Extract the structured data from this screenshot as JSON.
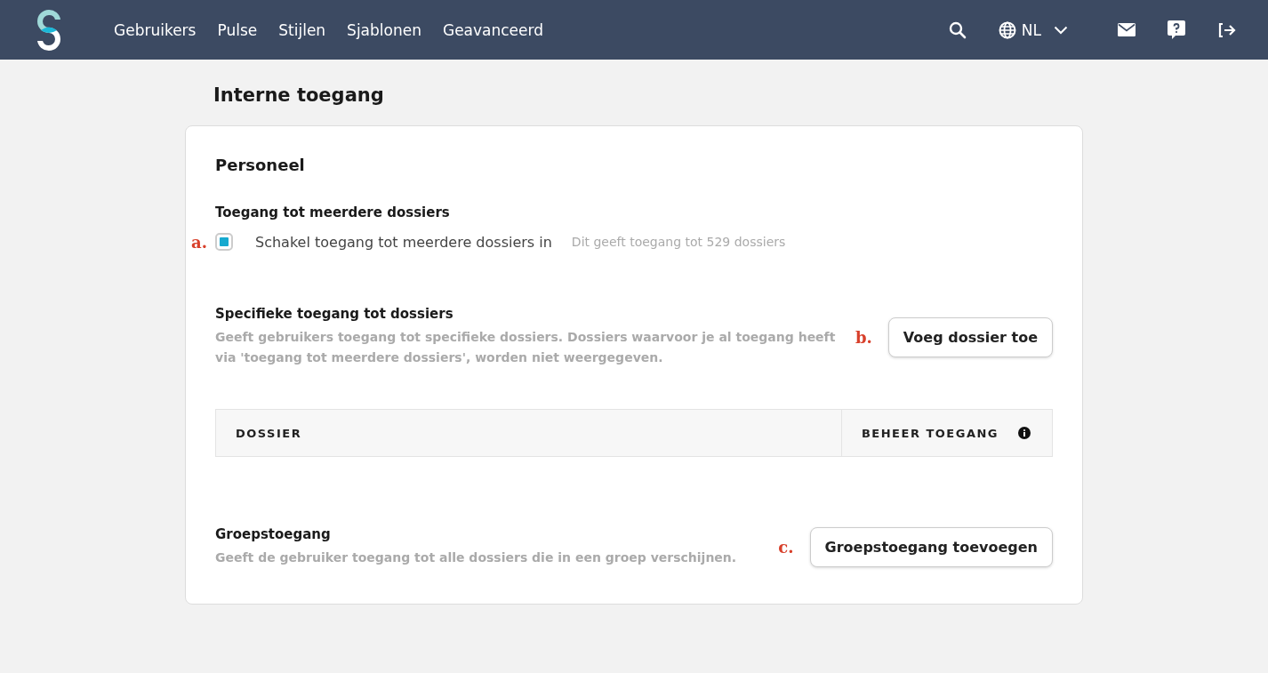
{
  "nav": {
    "items": [
      {
        "label": "Gebruikers"
      },
      {
        "label": "Pulse"
      },
      {
        "label": "Stijlen"
      },
      {
        "label": "Sjablonen"
      },
      {
        "label": "Geavanceerd"
      }
    ],
    "language": "NL"
  },
  "page_title": "Interne toegang",
  "card": {
    "title": "Personeel",
    "multi_access": {
      "heading": "Toegang tot meerdere dossiers",
      "marker": "a.",
      "checkbox": {
        "label": "Schakel toegang tot meerdere dossiers in",
        "checked": true
      },
      "hint": "Dit geeft toegang tot 529 dossiers"
    },
    "specific_access": {
      "heading": "Specifieke toegang tot dossiers",
      "description": "Geeft gebruikers toegang tot specifieke dossiers. Dossiers waarvoor je al toegang heeft via 'toegang tot meerdere dossiers', worden niet weergegeven.",
      "marker": "b.",
      "button": "Voeg dossier toe"
    },
    "table": {
      "columns": [
        "DOSSIER",
        "BEHEER TOEGANG"
      ]
    },
    "group_access": {
      "heading": "Groepstoegang",
      "description": "Geeft de gebruiker toegang tot alle dossiers die in een groep verschijnen.",
      "marker": "c.",
      "button": "Groepstoegang toevoegen"
    }
  }
}
